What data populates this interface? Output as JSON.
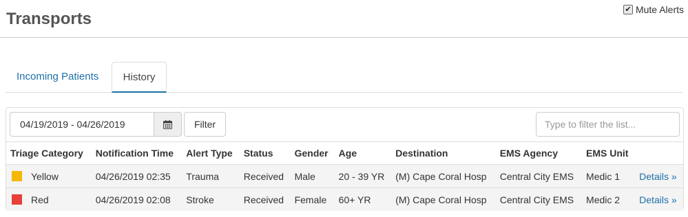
{
  "page": {
    "title": "Transports"
  },
  "mute": {
    "label": "Mute Alerts",
    "checked": true
  },
  "tabs": [
    {
      "label": "Incoming Patients",
      "active": false
    },
    {
      "label": "History",
      "active": true
    }
  ],
  "toolbar": {
    "date_range": "04/19/2019 - 04/26/2019",
    "calendar_icon": "calendar-icon",
    "filter_label": "Filter",
    "search_placeholder": "Type to filter the list..."
  },
  "table": {
    "columns": [
      "Triage Category",
      "Notification Time",
      "Alert Type",
      "Status",
      "Gender",
      "Age",
      "Destination",
      "EMS Agency",
      "EMS Unit",
      ""
    ],
    "rows": [
      {
        "triage": "Yellow",
        "triage_color": "#f5b800",
        "time": "04/26/2019 02:35",
        "alert_type": "Trauma",
        "status": "Received",
        "gender": "Male",
        "age": "20 - 39 YR",
        "destination": "(M) Cape Coral Hosp",
        "agency": "Central City EMS",
        "unit": "Medic 1",
        "details": "Details »"
      },
      {
        "triage": "Red",
        "triage_color": "#e8403a",
        "time": "04/26/2019 02:08",
        "alert_type": "Stroke",
        "status": "Received",
        "gender": "Female",
        "age": "60+ YR",
        "destination": "(M) Cape Coral Hosp",
        "agency": "Central City EMS",
        "unit": "Medic 2",
        "details": "Details »"
      }
    ]
  },
  "colors": {
    "link": "#1d6fa8",
    "border": "#dddddd",
    "stripe": "#f4f4f4"
  }
}
